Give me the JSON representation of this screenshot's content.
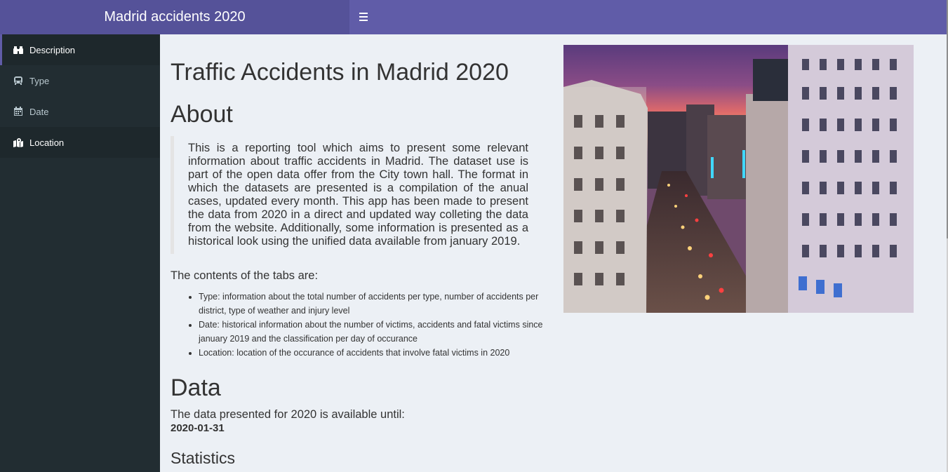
{
  "header": {
    "brand": "Madrid accidents 2020",
    "toggle_icon": "bars-icon"
  },
  "sidebar": {
    "items": [
      {
        "label": "Description",
        "icon": "binoculars-icon"
      },
      {
        "label": "Type",
        "icon": "bus-icon"
      },
      {
        "label": "Date",
        "icon": "calendar-icon"
      },
      {
        "label": "Location",
        "icon": "map-marked-icon"
      }
    ]
  },
  "main": {
    "title": "Traffic Accidents in Madrid 2020",
    "about_heading": "About",
    "about_text": "This is a reporting tool which aims to present some relevant information about traffic accidents in Madrid. The dataset use is part of the open data offer from the City town hall. The format in which the datasets are presented is a compilation of the anual cases, updated every month. This app has been made to present the data from 2020 in a direct and updated way colleting the data from the website. Additionally, some information is presented as a historical look using the unified data available from january 2019.",
    "tabs_intro": "The contents of the tabs are:",
    "tabs_list": [
      "Type: information about the total number of accidents per type, number of accidents per district, type of weather and injury level",
      "Date: historical information about the number of victims, accidents and fatal victims since january 2019 and the classification per day of occurance",
      "Location: location of the occurance of accidents that involve fatal victims in 2020"
    ],
    "data_heading": "Data",
    "data_text": "The data presented for 2020 is available until:",
    "data_date": "2020-01-31",
    "stats_heading": "Statistics"
  },
  "colors": {
    "header": "#605ca8",
    "brand": "#555299",
    "sidebar": "#222d32",
    "background": "#ecf0f5"
  }
}
